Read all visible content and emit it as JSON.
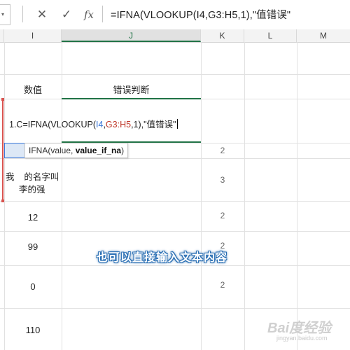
{
  "formula_bar": {
    "cancel_icon": "✕",
    "enter_icon": "✓",
    "fx_label": "fx",
    "formula": "=IFNA(VLOOKUP(I4,G3:H5,1),\"值错误\""
  },
  "columns": {
    "I": "I",
    "J": "J",
    "K": "K",
    "L": "L",
    "M": "M"
  },
  "cells": {
    "header_value": "数值",
    "header_judge": "错误判断",
    "formula_prefix": "1.C",
    "formula_start": "=IFNA(VLOOKUP(",
    "formula_ref1": "I4",
    "formula_comma": ",",
    "formula_ref2": "G3:H5",
    "formula_end": ",1),\"值错误\"",
    "name_line1": "我    的名字叫",
    "name_line2": "李的强",
    "i_12": "12",
    "i_99": "99",
    "i_0": "0",
    "i_110": "110"
  },
  "k_values": [
    "2",
    "3",
    "2",
    "2",
    "2"
  ],
  "tooltip": {
    "prefix": "IFNA(value, ",
    "bold": "value_if_na",
    "suffix": ")"
  },
  "caption": "也可以直接输入文本内容",
  "watermark": {
    "logo": "Bai度经验",
    "url": "jingyan.baidu.com"
  },
  "colors": {
    "excel_green": "#217346",
    "ref_blue": "#3c78d8",
    "ref_red": "#c0392b",
    "caption_outline": "#2a6fb4"
  }
}
